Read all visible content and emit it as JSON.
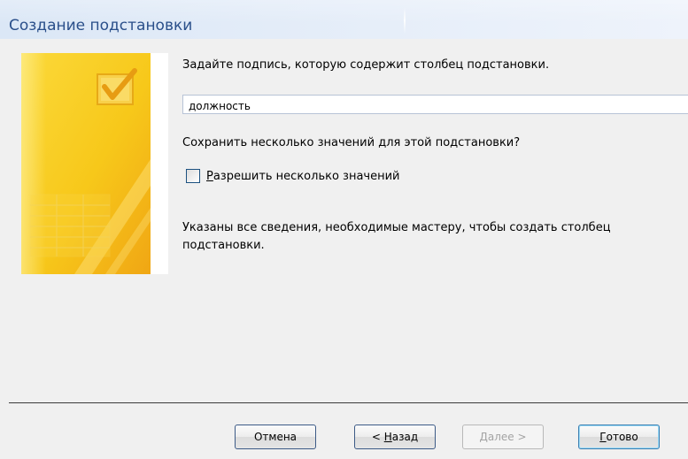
{
  "window": {
    "title": "Создание подстановки"
  },
  "main": {
    "prompt_label": "Задайте подпись, которую содержит столбец подстановки.",
    "caption_value": "должность",
    "multi_question": "Сохранить несколько значений для этой подстановки?",
    "allow_multiple": {
      "accel": "Р",
      "rest": "азрешить несколько значений",
      "checked": false
    },
    "info_line1": "Указаны все сведения, необходимые мастеру, чтобы создать столбец",
    "info_line2": "подстановки."
  },
  "buttons": {
    "cancel": {
      "label": "Отмена",
      "enabled": true
    },
    "back": {
      "prefix": "< ",
      "accel": "Н",
      "rest": "азад",
      "enabled": true
    },
    "next": {
      "accel": "Д",
      "rest": "алее >",
      "enabled": false
    },
    "finish": {
      "accel": "Г",
      "rest": "отово",
      "enabled": true,
      "default": true
    }
  },
  "colors": {
    "title_text": "#2a4f8a",
    "title_bar": "#dbe7f6",
    "art_yellow": "#f7c81a",
    "art_orange": "#f1a716",
    "dialog_bg": "#f0f0f0"
  },
  "icons": {
    "wizard_art": "checkmark-document-icon"
  }
}
